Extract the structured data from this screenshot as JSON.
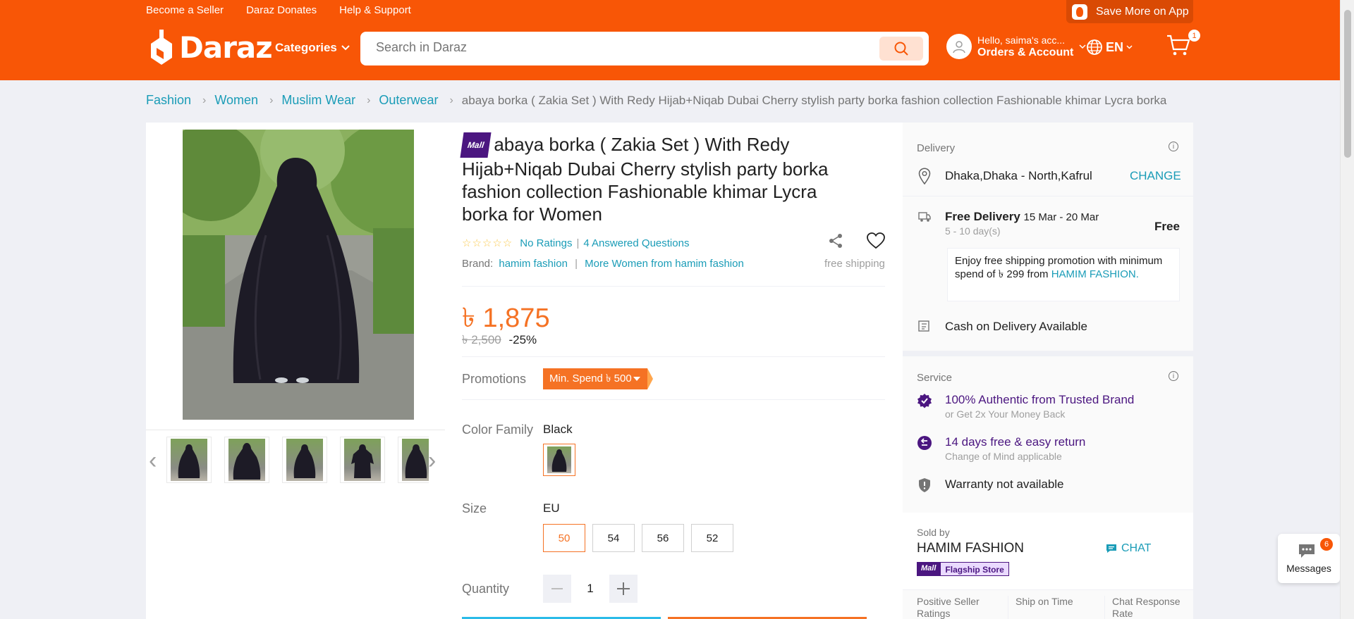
{
  "header": {
    "top_links": [
      "Become a Seller",
      "Daraz Donates",
      "Help & Support"
    ],
    "save_app": "Save More on App",
    "logo_text": "Daraz",
    "categories_label": "Categories",
    "search_placeholder": "Search in Daraz",
    "account_greeting": "Hello, saima's acc...",
    "account_label": "Orders & Account",
    "language": "EN",
    "cart_count": "1",
    "brand_color": "#f85606"
  },
  "breadcrumb": {
    "items": [
      "Fashion",
      "Women",
      "Muslim Wear",
      "Outerwear"
    ],
    "current": "abaya borka ( Zakia Set ) With Redy Hijab+Niqab Dubai Cherry stylish party borka fashion collection Fashionable khimar Lycra borka"
  },
  "product": {
    "mall_badge": "Mall",
    "title": "abaya borka ( Zakia Set ) With Redy Hijab+Niqab Dubai Cherry stylish party borka fashion collection Fashionable khimar Lycra borka for Women",
    "stars": "☆☆☆☆☆",
    "ratings_text": "No Ratings",
    "answered_questions": "4 Answered Questions",
    "brand_label": "Brand:",
    "brand_name": "hamim fashion",
    "more_from": "More Women from hamim fashion",
    "free_shipping": "free shipping",
    "price": "৳ 1,875",
    "original_price": "৳ 2,500",
    "discount": "-25%",
    "promotions_label": "Promotions",
    "promotion_tag": "Min. Spend ৳ 500",
    "color_family_label": "Color Family",
    "color_value": "Black",
    "size_label": "Size",
    "size_unit": "EU",
    "sizes": [
      "50",
      "54",
      "56",
      "52"
    ],
    "selected_size": "50",
    "quantity_label": "Quantity",
    "quantity": "1",
    "thumbnail_count": 5
  },
  "delivery": {
    "title": "Delivery",
    "location": "Dhaka,Dhaka - North,Kafrul",
    "change_label": "CHANGE",
    "free_delivery_label": "Free Delivery",
    "delivery_dates": "15 Mar - 20 Mar",
    "delivery_days": "5 - 10 day(s)",
    "delivery_price": "Free",
    "promo_text": "Enjoy free shipping promotion with minimum spend of ৳ 299 from",
    "promo_seller": "HAMIM FASHION.",
    "cod": "Cash on Delivery Available"
  },
  "service": {
    "title": "Service",
    "authentic": "100% Authentic from Trusted Brand",
    "authentic_sub": "or Get 2x Your Money Back",
    "returns": "14 days free & easy return",
    "returns_sub": "Change of Mind applicable",
    "warranty": "Warranty not available"
  },
  "seller": {
    "sold_by_label": "Sold by",
    "name": "HAMIM FASHION",
    "chat_label": "CHAT",
    "mall": "Mall",
    "flagship": "Flagship Store",
    "metric_1": "Positive Seller Ratings",
    "metric_2": "Ship on Time",
    "metric_3": "Chat Response Rate"
  },
  "messages": {
    "label": "Messages",
    "count": "6"
  }
}
